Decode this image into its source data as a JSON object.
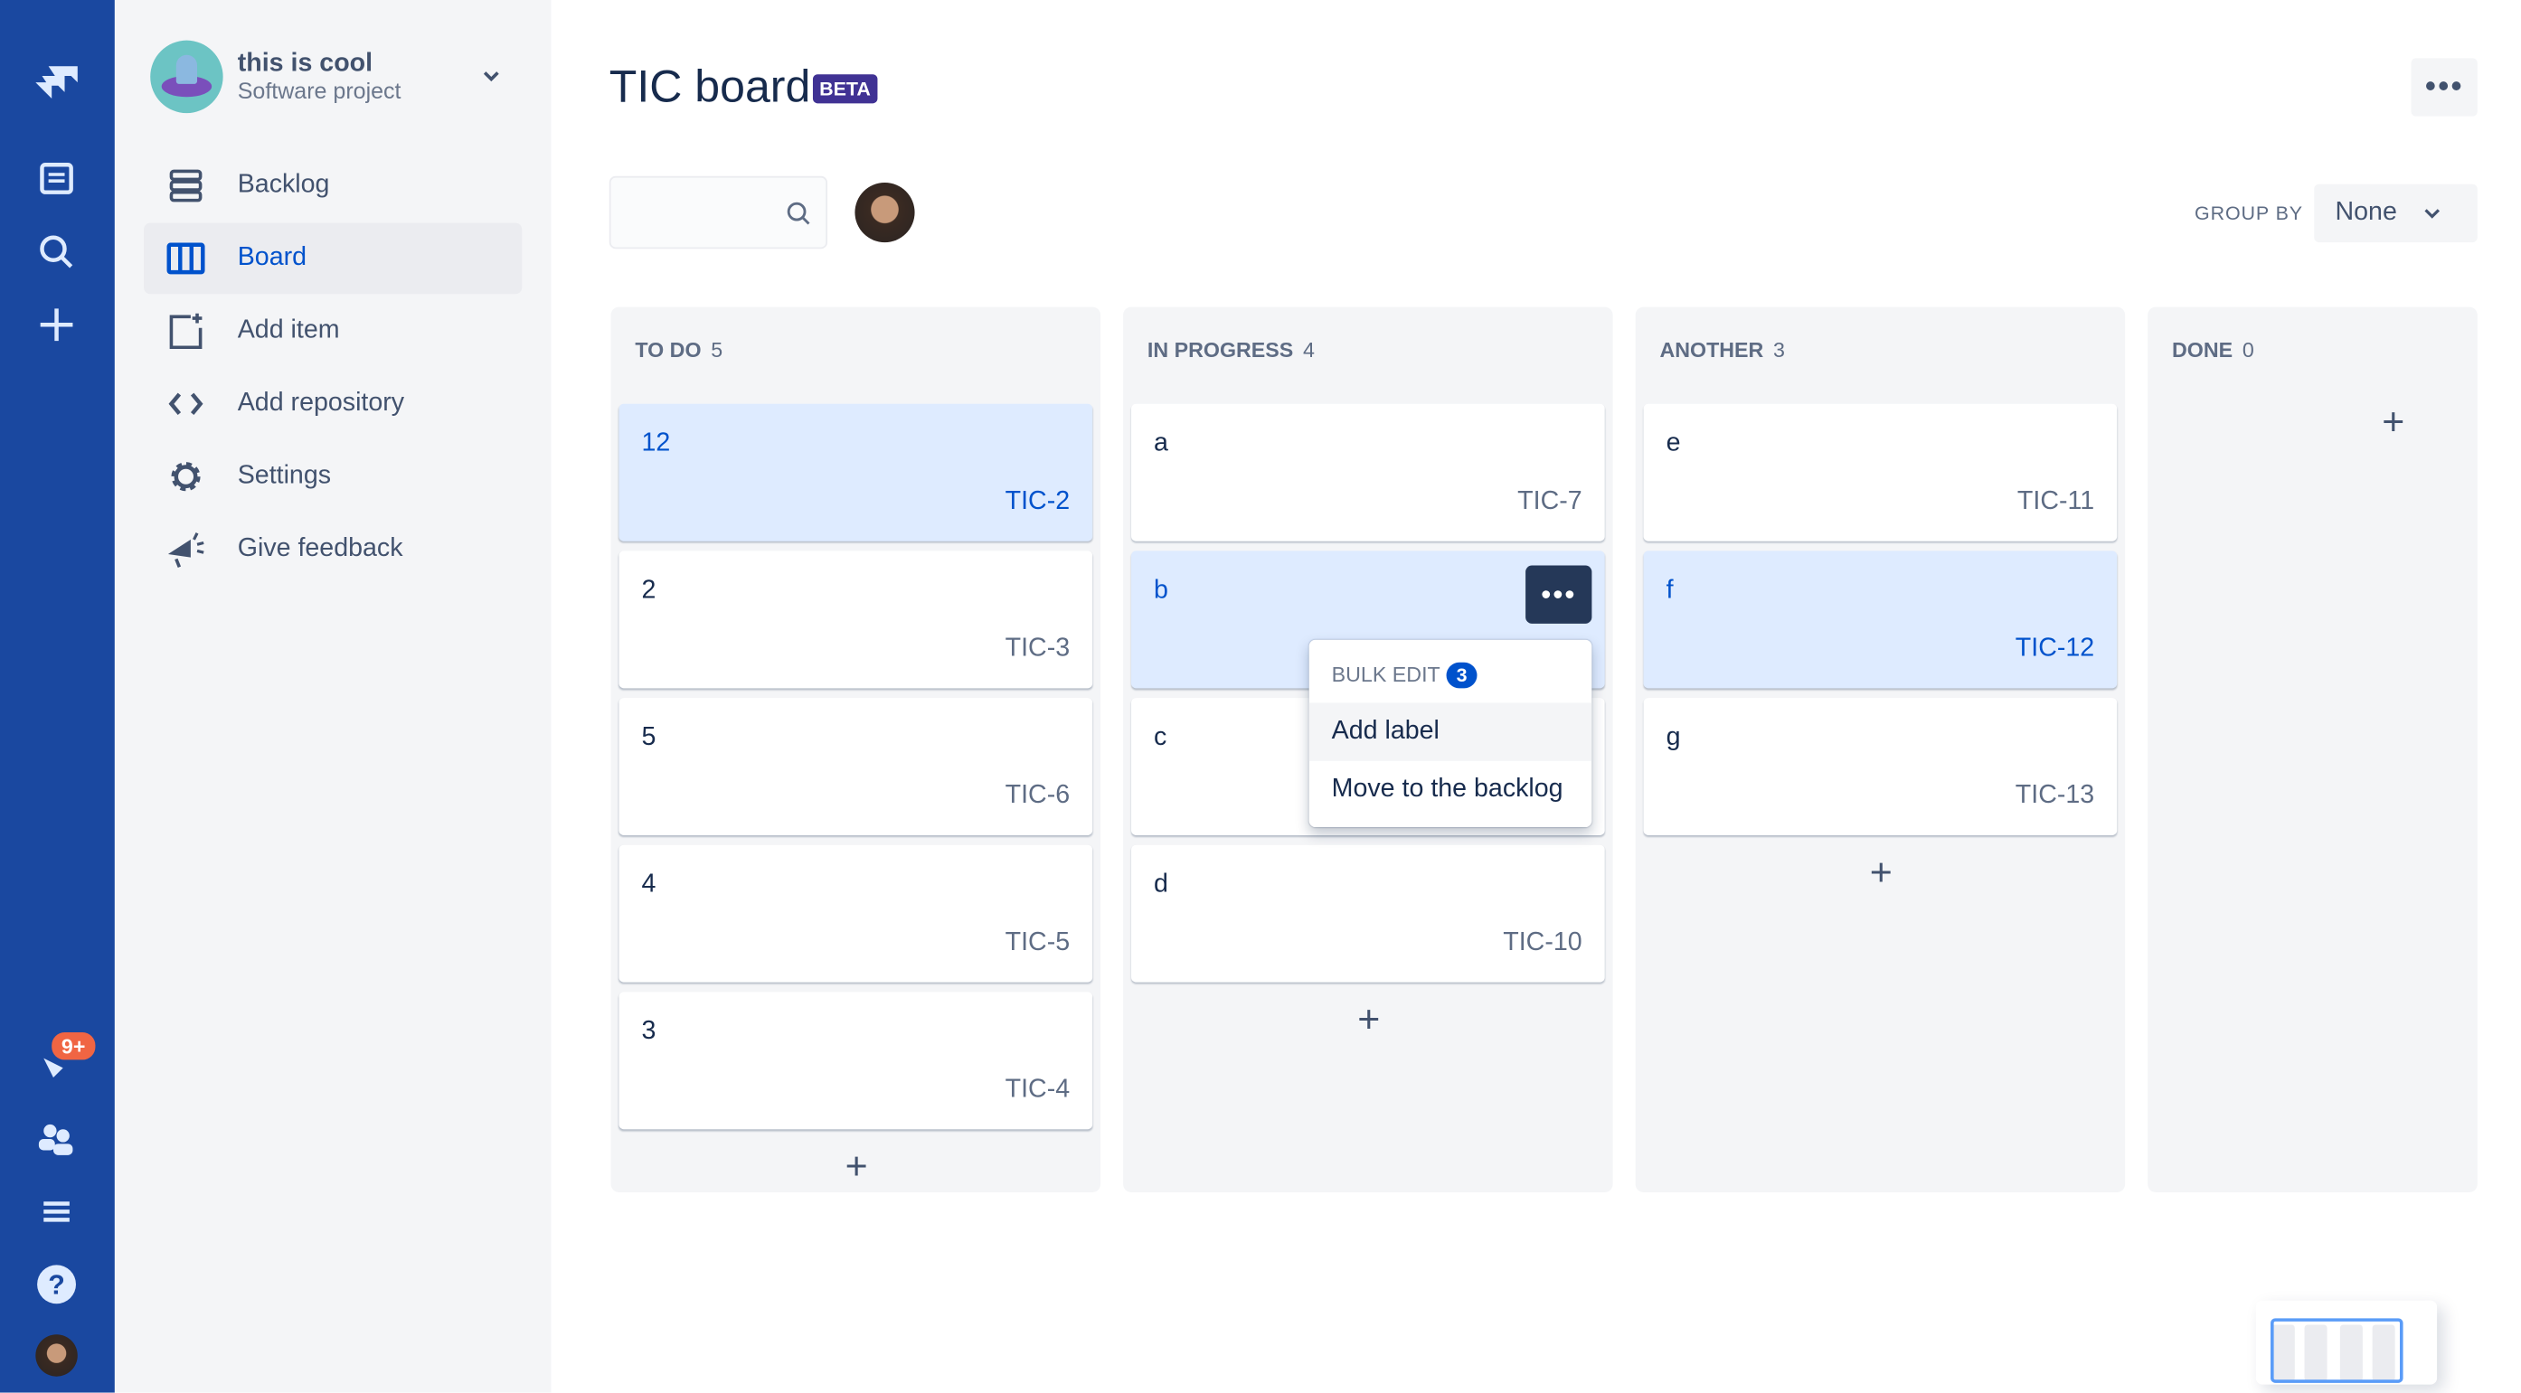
{
  "global_nav": {
    "notification_badge": "9+",
    "icons": [
      "jira-logo-icon",
      "feedback-board-icon",
      "search-icon",
      "create-icon",
      "notifications-icon",
      "people-icon",
      "menu-icon",
      "help-icon",
      "profile-avatar"
    ]
  },
  "project": {
    "name": "this is cool",
    "type": "Software project"
  },
  "sidebar": {
    "items": [
      {
        "label": "Backlog",
        "icon": "backlog-icon"
      },
      {
        "label": "Board",
        "icon": "board-icon",
        "active": true
      },
      {
        "label": "Add item",
        "icon": "add-item-icon"
      },
      {
        "label": "Add repository",
        "icon": "code-icon"
      },
      {
        "label": "Settings",
        "icon": "gear-icon"
      },
      {
        "label": "Give feedback",
        "icon": "megaphone-icon"
      }
    ]
  },
  "header": {
    "title": "TIC board",
    "badge": "BETA",
    "more": "•••"
  },
  "toolbar": {
    "search_placeholder": "",
    "group_by_label": "GROUP BY",
    "group_by_value": "None"
  },
  "columns": [
    {
      "title": "TO DO",
      "count": "5",
      "cards": [
        {
          "title": "12",
          "key": "TIC-2",
          "selected": true
        },
        {
          "title": "2",
          "key": "TIC-3"
        },
        {
          "title": "5",
          "key": "TIC-6"
        },
        {
          "title": "4",
          "key": "TIC-5"
        },
        {
          "title": "3",
          "key": "TIC-4"
        }
      ]
    },
    {
      "title": "IN PROGRESS",
      "count": "4",
      "cards": [
        {
          "title": "a",
          "key": "TIC-7"
        },
        {
          "title": "b",
          "key": "",
          "selected": true
        },
        {
          "title": "c",
          "key": ""
        },
        {
          "title": "d",
          "key": "TIC-10"
        }
      ]
    },
    {
      "title": "ANOTHER",
      "count": "3",
      "cards": [
        {
          "title": "e",
          "key": "TIC-11"
        },
        {
          "title": "f",
          "key": "TIC-12",
          "selected": true
        },
        {
          "title": "g",
          "key": "TIC-13"
        }
      ]
    },
    {
      "title": "DONE",
      "count": "0",
      "cards": []
    }
  ],
  "card_menu": {
    "button": "•••",
    "header": "BULK EDIT",
    "count": "3",
    "items": [
      "Add label",
      "Move to the backlog"
    ]
  },
  "add_label": "+",
  "colors": {
    "nav": "#1a48a0",
    "accent": "#0052cc",
    "selected_card": "#deebff",
    "badge": "#403294",
    "notification": "#f06543"
  }
}
